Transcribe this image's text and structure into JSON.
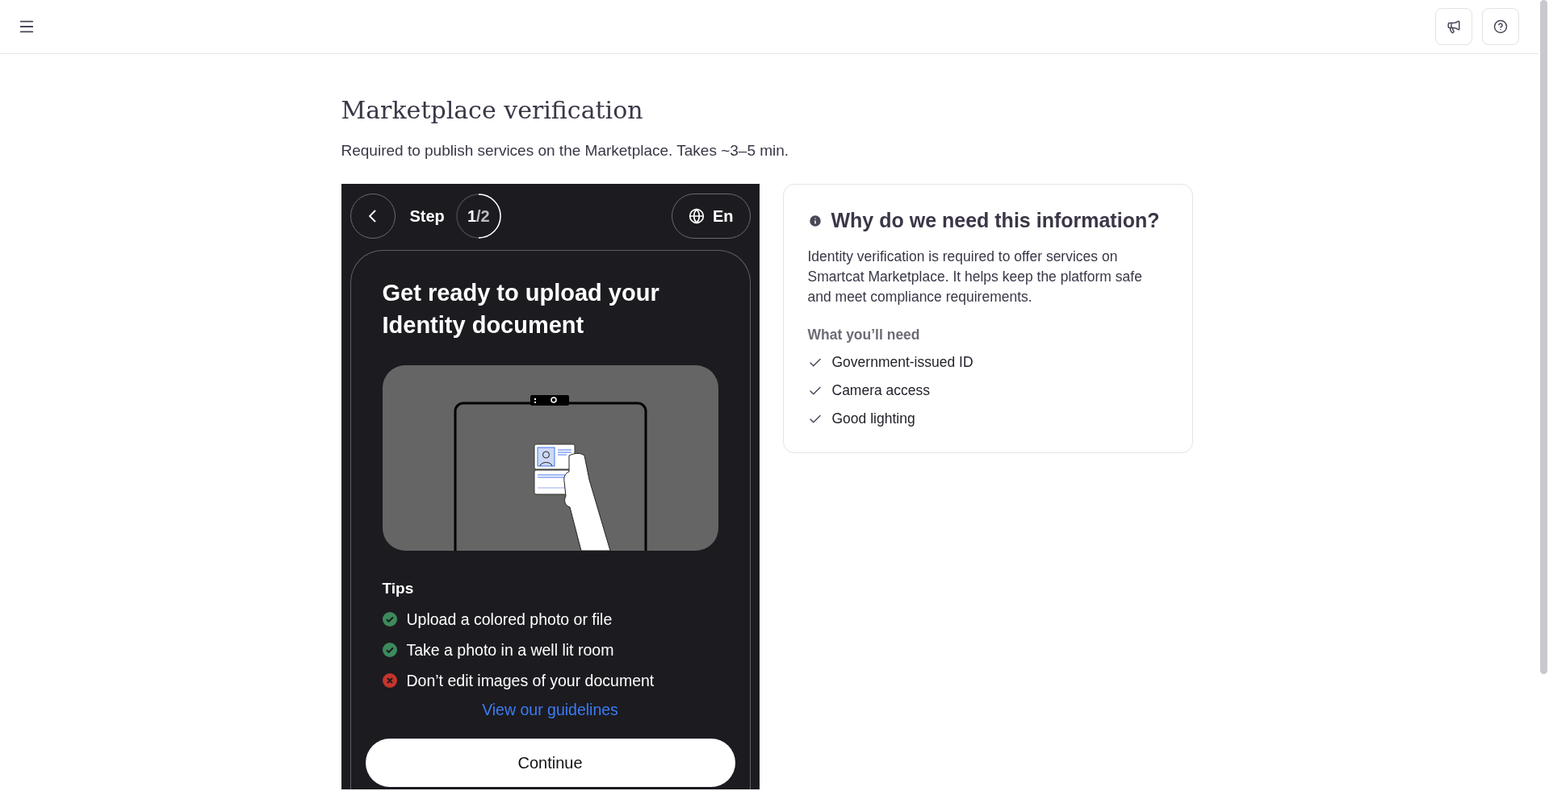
{
  "page": {
    "title": "Marketplace verification",
    "subtitle": "Required to publish services on the Marketplace. Takes ~3–5 min."
  },
  "widget": {
    "step_label": "Step",
    "step_current": "1",
    "step_total": "/2",
    "step": {
      "level": 0.5
    },
    "language": "En",
    "title": "Get ready to upload your Identity document",
    "tips_title": "Tips",
    "tips": [
      {
        "kind": "do",
        "text": "Upload a colored photo or file"
      },
      {
        "kind": "do",
        "text": "Take a photo in a well lit room"
      },
      {
        "kind": "dont",
        "text": "Don’t edit images of your document"
      }
    ],
    "guidelines_link": "View our guidelines",
    "continue_button": "Continue"
  },
  "info": {
    "title": "Why do we need this information?",
    "body": "Identity verification is required to offer services on Smartcat Marketplace. It helps keep the platform safe and meet compliance requirements.",
    "needs_title": "What you’ll need",
    "needs": [
      "Government-issued ID",
      "Camera access",
      "Good lighting"
    ]
  }
}
